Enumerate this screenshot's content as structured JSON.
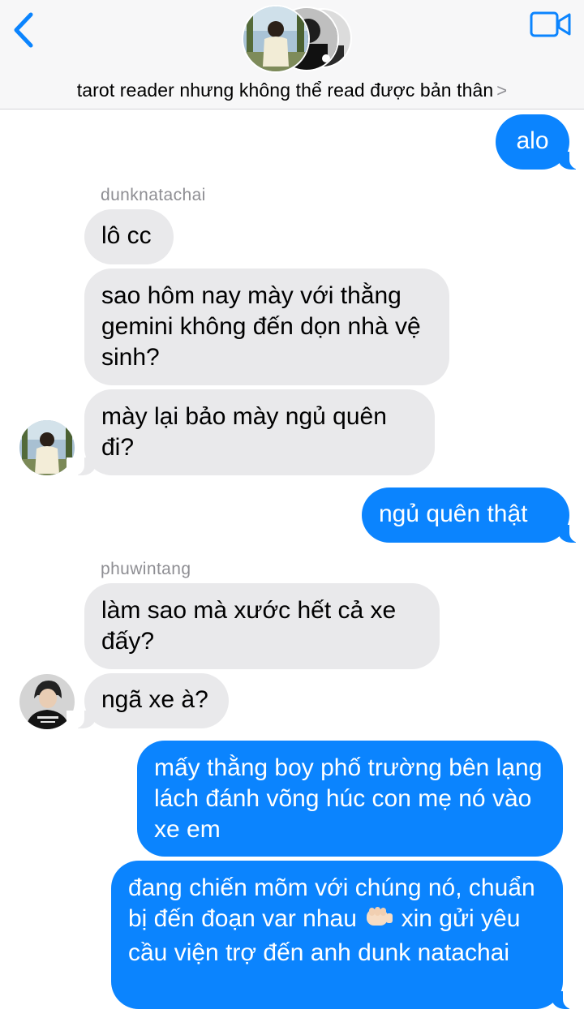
{
  "colors": {
    "accent": "#0b84fe",
    "incoming_bubble": "#e9e9eb",
    "sender_name": "#8e8e93",
    "header_bg": "#f7f7f8"
  },
  "header": {
    "back_icon": "chevron-left-icon",
    "video_icon": "video-camera-icon",
    "title": "tarot reader nhưng không thể read được bản thân",
    "title_chevron": ">"
  },
  "messages": [
    {
      "dir": "out",
      "text": "alo"
    },
    {
      "dir": "in",
      "sender": "dunknatachai",
      "text": "lô cc"
    },
    {
      "dir": "in",
      "text": "sao hôm nay mày với thằng gemini không đến dọn nhà vệ sinh?"
    },
    {
      "dir": "in",
      "text": "mày lại bảo mày ngủ quên đi?"
    },
    {
      "dir": "out",
      "text": "ngủ quên thật"
    },
    {
      "dir": "in",
      "sender": "phuwintang",
      "text": "làm sao mà xước hết cả xe đấy?"
    },
    {
      "dir": "in",
      "text": "ngã xe à?"
    },
    {
      "dir": "out",
      "text": "mấy thằng boy phố trường bên lạng lách đánh võng húc con mẹ nó vào xe em"
    },
    {
      "dir": "out",
      "text_before": "đang chiến mõm với chúng nó, chuẩn bị đến đoạn var nhau",
      "emoji": "oncoming-fist-emoji",
      "text_after": "xin gửi yêu cầu viện trợ đến anh dunk natachai"
    }
  ]
}
